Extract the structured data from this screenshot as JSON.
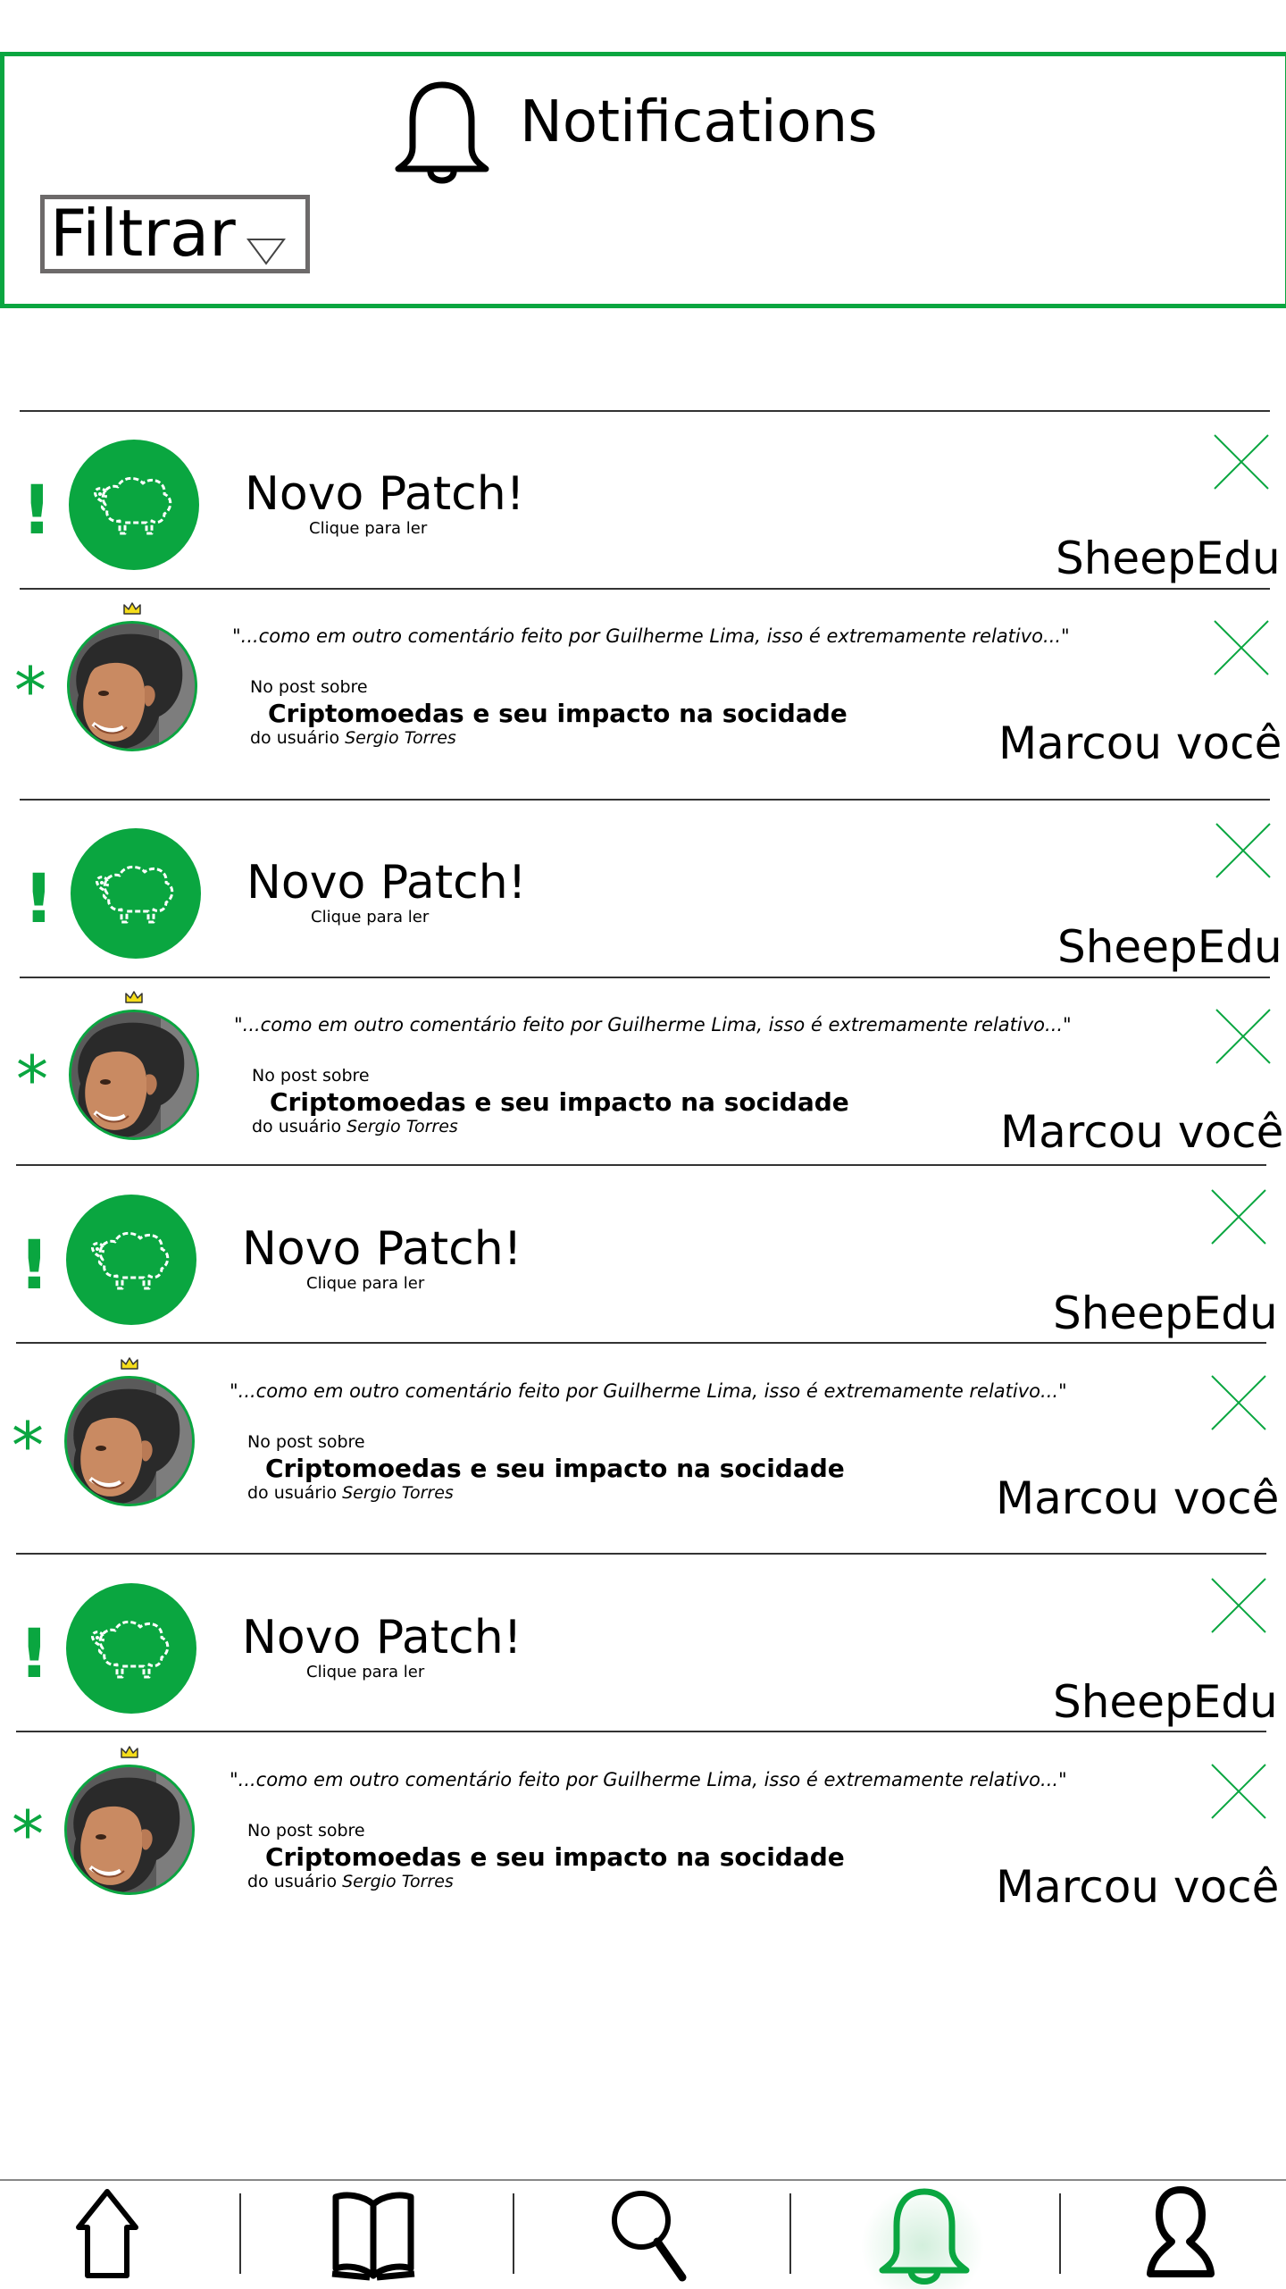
{
  "header": {
    "title": "Notifications",
    "filter_label": "Filtrar",
    "icon": "bell-icon"
  },
  "colors": {
    "accent": "#0aa640",
    "crown": "#f5dd1b",
    "divider": "#333333",
    "filter_border": "#6d6a6a"
  },
  "notifications": [
    {
      "type": "patch",
      "marker": "!",
      "title": "Novo Patch!",
      "subtitle": "Clique para ler",
      "source": "SheepEdu",
      "icon": "sheep-icon"
    },
    {
      "type": "mention",
      "marker": "*",
      "quote": "\"...como em outro comentário feito por Guilherme Lima, isso é extremamente relativo...\"",
      "post_prefix": "No post sobre",
      "post_title": "Criptomoedas e seu impacto na socidade",
      "user_prefix": "do usuário",
      "user_name": "Sergio Torres",
      "action": "Marcou você",
      "icon": "crown-icon"
    },
    {
      "type": "patch",
      "marker": "!",
      "title": "Novo Patch!",
      "subtitle": "Clique para ler",
      "source": "SheepEdu",
      "icon": "sheep-icon"
    },
    {
      "type": "mention",
      "marker": "*",
      "quote": "\"...como em outro comentário feito por Guilherme Lima, isso é extremamente relativo...\"",
      "post_prefix": "No post sobre",
      "post_title": "Criptomoedas e seu impacto na socidade",
      "user_prefix": "do usuário",
      "user_name": "Sergio Torres",
      "action": "Marcou você",
      "icon": "crown-icon"
    },
    {
      "type": "patch",
      "marker": "!",
      "title": "Novo Patch!",
      "subtitle": "Clique para ler",
      "source": "SheepEdu",
      "icon": "sheep-icon"
    },
    {
      "type": "mention",
      "marker": "*",
      "quote": "\"...como em outro comentário feito por Guilherme Lima, isso é extremamente relativo...\"",
      "post_prefix": "No post sobre",
      "post_title": "Criptomoedas e seu impacto na socidade",
      "user_prefix": "do usuário",
      "user_name": "Sergio Torres",
      "action": "Marcou você",
      "icon": "crown-icon"
    },
    {
      "type": "patch",
      "marker": "!",
      "title": "Novo Patch!",
      "subtitle": "Clique para ler",
      "source": "SheepEdu",
      "icon": "sheep-icon"
    },
    {
      "type": "mention",
      "marker": "*",
      "quote": "\"...como em outro comentário feito por Guilherme Lima, isso é extremamente relativo...\"",
      "post_prefix": "No post sobre",
      "post_title": "Criptomoedas e seu impacto na socidade",
      "user_prefix": "do usuário",
      "user_name": "Sergio Torres",
      "action": "Marcou você",
      "icon": "crown-icon"
    }
  ],
  "tabbar": {
    "items": [
      {
        "icon": "home-icon"
      },
      {
        "icon": "book-icon"
      },
      {
        "icon": "search-icon"
      },
      {
        "icon": "bell-icon",
        "active": true
      },
      {
        "icon": "profile-icon"
      }
    ]
  }
}
